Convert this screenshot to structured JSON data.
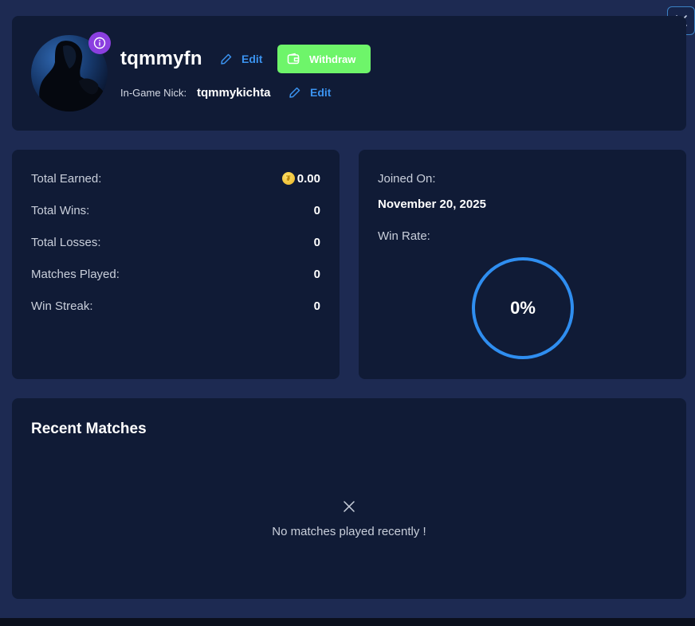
{
  "colors": {
    "background": "#1d2a52",
    "card": "#101b36",
    "accent_blue": "#3b93f0",
    "withdraw_green": "#6ef56a",
    "info_purple": "#8b3fe0",
    "ring_blue": "#2f8ef0"
  },
  "profile": {
    "username": "tqmmyfn",
    "edit_label": "Edit",
    "withdraw_label": "Withdraw",
    "nick_label": "In-Game Nick:",
    "nick_value": "tqmmykichta",
    "nick_edit_label": "Edit",
    "avatar_icon": "hooded-figure-avatar",
    "info_icon": "info-icon"
  },
  "stats": [
    {
      "label": "Total Earned:",
      "value": "0.00",
      "icon": "coin-icon"
    },
    {
      "label": "Total Wins:",
      "value": "0"
    },
    {
      "label": "Total Losses:",
      "value": "0"
    },
    {
      "label": "Matches Played:",
      "value": "0"
    },
    {
      "label": "Win Streak:",
      "value": "0"
    }
  ],
  "joined": {
    "label": "Joined On:",
    "value": "November 20, 2025",
    "winrate_label": "Win Rate:",
    "winrate_text": "0%",
    "winrate_fraction": 0
  },
  "matches": {
    "title": "Recent Matches",
    "empty_text": "No matches played recently !"
  }
}
